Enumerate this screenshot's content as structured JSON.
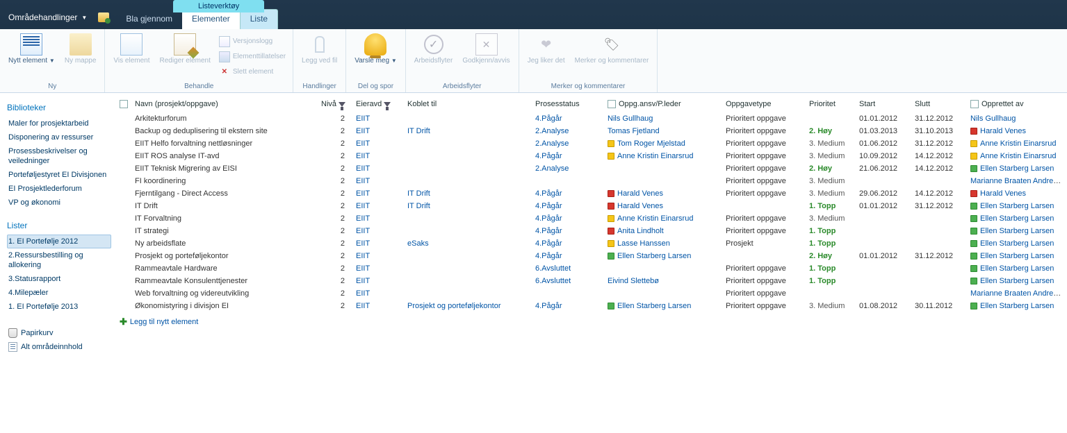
{
  "header": {
    "site_actions": "Områdehandlinger",
    "context_group": "Listeverktøy",
    "tabs": {
      "browse": "Bla gjennom",
      "elements": "Elementer",
      "list": "Liste"
    }
  },
  "ribbon": {
    "groups": {
      "ny": {
        "label": "Ny",
        "new_item": "Nytt\nelement",
        "new_folder": "Ny\nmappe"
      },
      "behandle": {
        "label": "Behandle",
        "view": "Vis\nelement",
        "edit": "Rediger\nelement",
        "version": "Versjonslogg",
        "perms": "Elementtillatelser",
        "delete": "Slett element"
      },
      "handlinger": {
        "label": "Handlinger",
        "attach": "Legg ved\nfil"
      },
      "delspor": {
        "label": "Del og spor",
        "alert": "Varsle\nmeg"
      },
      "arbeidsflyter": {
        "label": "Arbeidsflyter",
        "workflows": "Arbeidsflyter",
        "approve": "Godkjenn/avvis"
      },
      "merker": {
        "label": "Merker og kommentarer",
        "like": "Jeg liker\ndet",
        "tags": "Merker og\nkommentarer"
      }
    }
  },
  "sidebar": {
    "libraries_hdr": "Biblioteker",
    "libraries": [
      "Maler for prosjektarbeid",
      "Disponering av ressurser",
      "Prosessbeskrivelser og veiledninger",
      "Porteføljestyret EI Divisjonen",
      "EI Prosjektlederforum",
      "VP og økonomi"
    ],
    "lists_hdr": "Lister",
    "lists": [
      "1. EI Portefølje 2012",
      "2.Ressursbestilling og allokering",
      "3.Statusrapport",
      "4.Milepæler",
      "1. EI Portefølje 2013"
    ],
    "recycle": "Papirkurv",
    "allcontent": "Alt områdeinnhold"
  },
  "columns": {
    "name": "Navn (prosjekt/oppgave)",
    "level": "Nivå",
    "owner_dept": "Eieravd",
    "linked": "Koblet til",
    "status": "Prosesstatus",
    "responsible": "Oppg.ansv/P.leder",
    "type": "Oppgavetype",
    "priority": "Prioritet",
    "start": "Start",
    "end": "Slutt",
    "created_by": "Opprettet av"
  },
  "priorities": {
    "top": "1. Topp",
    "high": "2. Høy",
    "medium": "3. Medium"
  },
  "type_prioritert": "Prioritert oppgave",
  "type_prosjekt": "Prosjekt",
  "rows": [
    {
      "name": "Arkitekturforum",
      "level": "2",
      "dept": "EIIT",
      "linked": "",
      "status": "4.Pågår",
      "resp": "Nils Gullhaug",
      "resp_color": "",
      "type": "Prioritert oppgave",
      "prio": "",
      "start": "01.01.2012",
      "end": "31.12.2012",
      "by": "Nils Gullhaug",
      "by_color": ""
    },
    {
      "name": "Backup og deduplisering til ekstern site",
      "level": "2",
      "dept": "EIIT",
      "linked": "IT Drift",
      "status": "2.Analyse",
      "resp": "Tomas Fjetland",
      "resp_color": "",
      "type": "Prioritert oppgave",
      "prio": "2. Høy",
      "start": "01.03.2013",
      "end": "31.10.2013",
      "by": "Harald Venes",
      "by_color": "red"
    },
    {
      "name": "EIIT Helfo forvaltning nettløsninger",
      "level": "2",
      "dept": "EIIT",
      "linked": "",
      "status": "2.Analyse",
      "resp": "Tom Roger Mjelstad",
      "resp_color": "yellow",
      "type": "Prioritert oppgave",
      "prio": "3. Medium",
      "start": "01.06.2012",
      "end": "31.12.2012",
      "by": "Anne Kristin Einarsrud",
      "by_color": "yellow"
    },
    {
      "name": "EIIT ROS analyse IT-avd",
      "level": "2",
      "dept": "EIIT",
      "linked": "",
      "status": "4.Pågår",
      "resp": "Anne Kristin Einarsrud",
      "resp_color": "yellow",
      "type": "Prioritert oppgave",
      "prio": "3. Medium",
      "start": "10.09.2012",
      "end": "14.12.2012",
      "by": "Anne Kristin Einarsrud",
      "by_color": "yellow"
    },
    {
      "name": "EIIT Teknisk Migrering av EISI",
      "level": "2",
      "dept": "EIIT",
      "linked": "",
      "status": "2.Analyse",
      "resp": "",
      "resp_color": "",
      "type": "Prioritert oppgave",
      "prio": "2. Høy",
      "start": "21.06.2012",
      "end": "14.12.2012",
      "by": "Ellen Starberg Larsen",
      "by_color": "green"
    },
    {
      "name": "FI koordinering",
      "level": "2",
      "dept": "EIIT",
      "linked": "",
      "status": "",
      "resp": "",
      "resp_color": "",
      "type": "Prioritert oppgave",
      "prio": "3. Medium",
      "start": "",
      "end": "",
      "by": "Marianne Braaten Andresen",
      "by_color": ""
    },
    {
      "name": "Fjerntilgang - Direct Access",
      "level": "2",
      "dept": "EIIT",
      "linked": "IT Drift",
      "status": "4.Pågår",
      "resp": "Harald Venes",
      "resp_color": "red",
      "type": "Prioritert oppgave",
      "prio": "3. Medium",
      "start": "29.06.2012",
      "end": "14.12.2012",
      "by": "Harald Venes",
      "by_color": "red"
    },
    {
      "name": "IT Drift",
      "level": "2",
      "dept": "EIIT",
      "linked": "IT Drift",
      "status": "4.Pågår",
      "resp": "Harald Venes",
      "resp_color": "red",
      "type": "",
      "prio": "1. Topp",
      "start": "01.01.2012",
      "end": "31.12.2012",
      "by": "Ellen Starberg Larsen",
      "by_color": "green"
    },
    {
      "name": "IT Forvaltning",
      "level": "2",
      "dept": "EIIT",
      "linked": "",
      "status": "4.Pågår",
      "resp": "Anne Kristin Einarsrud",
      "resp_color": "yellow",
      "type": "Prioritert oppgave",
      "prio": "3. Medium",
      "start": "",
      "end": "",
      "by": "Ellen Starberg Larsen",
      "by_color": "green"
    },
    {
      "name": "IT strategi",
      "level": "2",
      "dept": "EIIT",
      "linked": "",
      "status": "4.Pågår",
      "resp": "Anita Lindholt",
      "resp_color": "red",
      "type": "Prioritert oppgave",
      "prio": "1. Topp",
      "start": "",
      "end": "",
      "by": "Ellen Starberg Larsen",
      "by_color": "green"
    },
    {
      "name": "Ny arbeidsflate",
      "level": "2",
      "dept": "EIIT",
      "linked": "eSaks",
      "status": "4.Pågår",
      "resp": "Lasse Hanssen",
      "resp_color": "yellow",
      "type": "Prosjekt",
      "prio": "1. Topp",
      "start": "",
      "end": "",
      "by": "Ellen Starberg Larsen",
      "by_color": "green"
    },
    {
      "name": "Prosjekt og porteføljekontor",
      "level": "2",
      "dept": "EIIT",
      "linked": "",
      "status": "4.Pågår",
      "resp": "Ellen Starberg Larsen",
      "resp_color": "green",
      "type": "",
      "prio": "2. Høy",
      "start": "01.01.2012",
      "end": "31.12.2012",
      "by": "Ellen Starberg Larsen",
      "by_color": "green"
    },
    {
      "name": "Rammeavtale Hardware",
      "level": "2",
      "dept": "EIIT",
      "linked": "",
      "status": "6.Avsluttet",
      "resp": "",
      "resp_color": "",
      "type": "Prioritert oppgave",
      "prio": "1. Topp",
      "start": "",
      "end": "",
      "by": "Ellen Starberg Larsen",
      "by_color": "green"
    },
    {
      "name": "Rammeavtale Konsulenttjenester",
      "level": "2",
      "dept": "EIIT",
      "linked": "",
      "status": "6.Avsluttet",
      "resp": "Eivind Slettebø",
      "resp_color": "",
      "type": "Prioritert oppgave",
      "prio": "1. Topp",
      "start": "",
      "end": "",
      "by": "Ellen Starberg Larsen",
      "by_color": "green"
    },
    {
      "name": "Web forvaltning og videreutvikling",
      "level": "2",
      "dept": "EIIT",
      "linked": "",
      "status": "",
      "resp": "",
      "resp_color": "",
      "type": "Prioritert oppgave",
      "prio": "",
      "start": "",
      "end": "",
      "by": "Marianne Braaten Andresen",
      "by_color": ""
    },
    {
      "name": "Økonomistyring i divisjon EI",
      "level": "2",
      "dept": "EIIT",
      "linked": "Prosjekt og porteføljekontor",
      "status": "4.Pågår",
      "resp": "Ellen Starberg Larsen",
      "resp_color": "green",
      "type": "Prioritert oppgave",
      "prio": "3. Medium",
      "start": "01.08.2012",
      "end": "30.11.2012",
      "by": "Ellen Starberg Larsen",
      "by_color": "green"
    }
  ],
  "add_new": "Legg til nytt element"
}
